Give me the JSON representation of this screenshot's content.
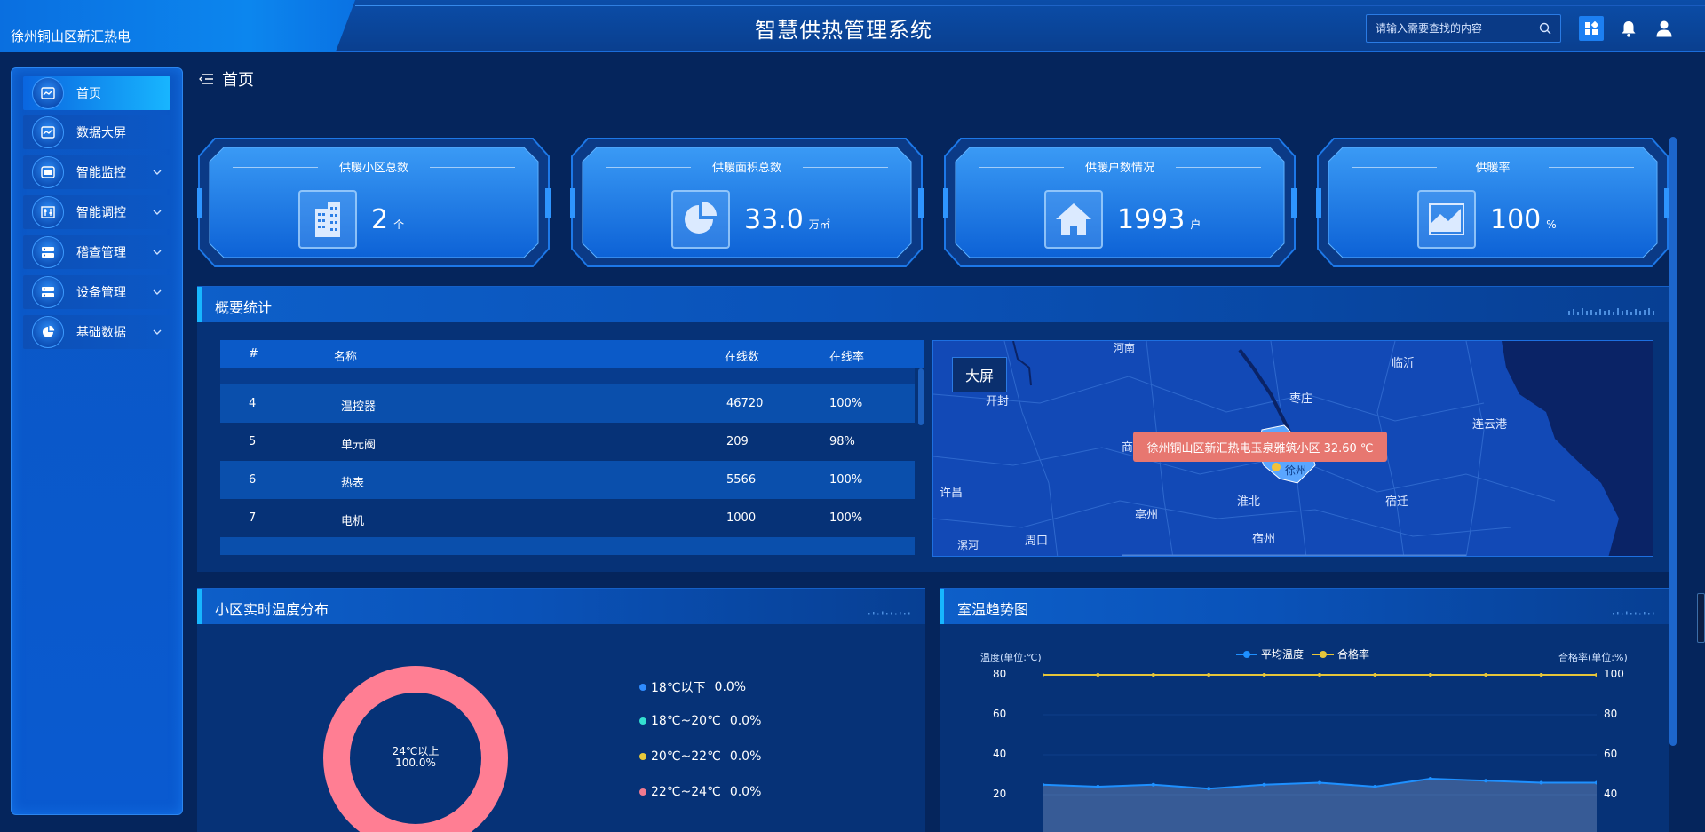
{
  "header": {
    "org_name": "徐州铜山区新汇热电",
    "system_title": "智慧供热管理系统",
    "search_placeholder": "请输入需要查找的内容"
  },
  "sidebar": {
    "items": [
      {
        "label": "首页",
        "icon": "chart-icon",
        "active": true
      },
      {
        "label": "数据大屏",
        "icon": "chart-icon"
      },
      {
        "label": "智能监控",
        "icon": "monitor-icon"
      },
      {
        "label": "智能调控",
        "icon": "equalizer-icon"
      },
      {
        "label": "稽查管理",
        "icon": "server-icon"
      },
      {
        "label": "设备管理",
        "icon": "server-icon"
      },
      {
        "label": "基础数据",
        "icon": "pie-icon"
      }
    ]
  },
  "page": {
    "title": "首页"
  },
  "stats": [
    {
      "label": "供暖小区总数",
      "value": "2",
      "unit": "个",
      "icon": "building-icon"
    },
    {
      "label": "供暖面积总数",
      "value": "33.0",
      "unit": "万㎡",
      "icon": "pie-chart-icon"
    },
    {
      "label": "供暖户数情况",
      "value": "1993",
      "unit": "户",
      "icon": "home-icon"
    },
    {
      "label": "供暖率",
      "value": "100",
      "unit": "%",
      "icon": "area-chart-icon"
    }
  ],
  "overview": {
    "title": "概要统计",
    "table": {
      "headers": [
        "#",
        "名称",
        "在线数",
        "在线率"
      ],
      "rows": [
        {
          "idx": "4",
          "name": "温控器",
          "online": "46720",
          "rate": "100%"
        },
        {
          "idx": "5",
          "name": "单元阀",
          "online": "209",
          "rate": "98%"
        },
        {
          "idx": "6",
          "name": "热表",
          "online": "5566",
          "rate": "100%"
        },
        {
          "idx": "7",
          "name": "电机",
          "online": "1000",
          "rate": "100%"
        }
      ]
    },
    "map": {
      "bigscreen_label": "大屏",
      "tooltip": "徐州铜山区新汇热电玉泉雅筑小区 32.60 ℃",
      "cities": [
        "河南",
        "临沂",
        "枣庄",
        "开封",
        "商",
        "连云港",
        "许昌",
        "淮北",
        "宿迁",
        "亳州",
        "周口",
        "宿州",
        "漯河",
        "徐州"
      ]
    }
  },
  "temp_dist": {
    "title": "小区实时温度分布",
    "center_label": "24℃以上",
    "center_value": "100.0%",
    "legend": [
      {
        "label": "18℃以下",
        "value": "0.0%",
        "color": "#2f8cff"
      },
      {
        "label": "18℃~20℃",
        "value": "0.0%",
        "color": "#34e0d0"
      },
      {
        "label": "20℃~22℃",
        "value": "0.0%",
        "color": "#e7c93b"
      },
      {
        "label": "22℃~24℃",
        "value": "0.0%",
        "color": "#f07a8f"
      }
    ],
    "ring_color": "#ff7e93"
  },
  "trend": {
    "title": "室温趋势图",
    "legend": [
      "平均温度",
      "合格率"
    ],
    "left_axis_label": "温度(单位:℃)",
    "right_axis_label": "合格率(单位:%)",
    "left_ticks": [
      "80",
      "60",
      "40",
      "20"
    ],
    "right_ticks": [
      "100",
      "80",
      "60",
      "40"
    ]
  },
  "chart_data": {
    "type": "line",
    "x": [
      1,
      2,
      3,
      4,
      5,
      6,
      7,
      8,
      9,
      10,
      11
    ],
    "series": [
      {
        "name": "平均温度",
        "axis": "left",
        "values": [
          25,
          24,
          25,
          23,
          25,
          26,
          24,
          28,
          27,
          26,
          26
        ],
        "color": "#1e90ff"
      },
      {
        "name": "合格率",
        "axis": "right",
        "values": [
          100,
          100,
          100,
          100,
          100,
          100,
          100,
          100,
          100,
          100,
          100
        ],
        "color": "#e5c53a"
      }
    ],
    "ylim_left": [
      0,
      80
    ],
    "ylim_right": [
      20,
      100
    ]
  }
}
